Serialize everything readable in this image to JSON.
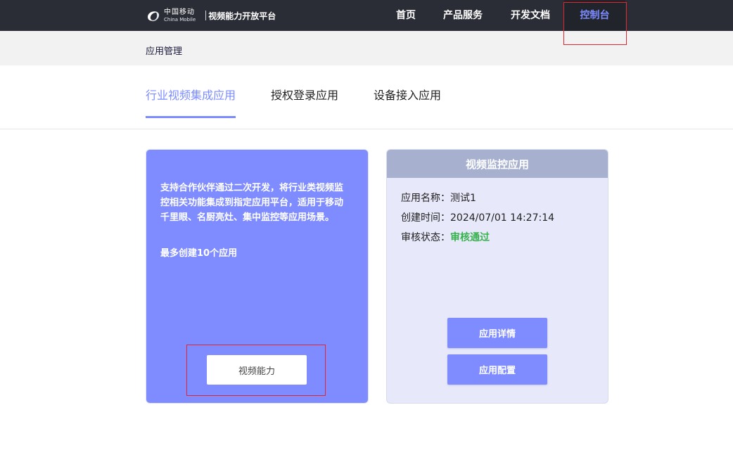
{
  "header": {
    "logo_cn": "中国移动",
    "logo_en": "China Mobile",
    "platform_name": "视频能力开放平台",
    "nav": [
      {
        "label": "首页"
      },
      {
        "label": "产品服务"
      },
      {
        "label": "开发文档"
      },
      {
        "label": "控制台",
        "active": true
      }
    ]
  },
  "breadcrumb": "应用管理",
  "tabs": [
    {
      "label": "行业视频集成应用",
      "active": true
    },
    {
      "label": "授权登录应用"
    },
    {
      "label": "设备接入应用"
    }
  ],
  "left_card": {
    "description": "支持合作伙伴通过二次开发，将行业类视频监控相关功能集成到指定应用平台，适用于移动千里眼、名厨亮灶、集中监控等应用场景。",
    "limit_text": "最多创建10个应用",
    "button_label": "视频能力"
  },
  "app_card": {
    "title": "视频监控应用",
    "name_label": "应用名称：",
    "name_value": "测试1",
    "created_label": "创建时间：",
    "created_value": "2024/07/01 14:27:14",
    "status_label": "审核状态：",
    "status_value": "审核通过",
    "detail_button": "应用详情",
    "config_button": "应用配置"
  },
  "colors": {
    "accent": "#7f8cff",
    "topbar": "#2b2d36",
    "status_ok": "#37b24d",
    "highlight_box": "#e0262e"
  }
}
